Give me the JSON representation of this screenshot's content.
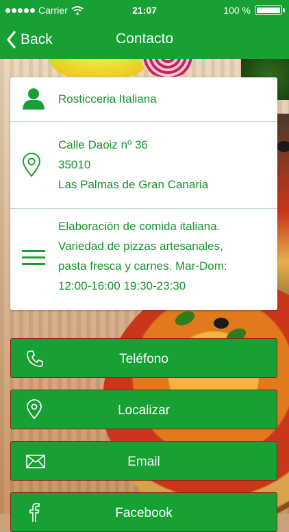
{
  "status_bar": {
    "carrier": "Carrier",
    "time": "21:07",
    "battery": "100 %"
  },
  "nav": {
    "back_label": "Back",
    "title": "Contacto"
  },
  "info": {
    "name": "Rosticceria Italiana",
    "address_lines": [
      "Calle Daoiz nº 36",
      "35010",
      "Las Palmas de Gran Canaria"
    ],
    "description_lines": [
      "Elaboración de comida italiana.",
      "Variedad de pizzas artesanales,",
      "pasta fresca y carnes. Mar-Dom:",
      "12:00-16:00 19:30-23:30"
    ]
  },
  "buttons": [
    {
      "label": "Teléfono",
      "icon": "phone-icon"
    },
    {
      "label": "Localizar",
      "icon": "location-pin-icon"
    },
    {
      "label": "Email",
      "icon": "envelope-icon"
    },
    {
      "label": "Facebook",
      "icon": "facebook-icon"
    }
  ],
  "colors": {
    "primary": "#17a033",
    "text": "#15952d",
    "divider": "#bfe0c4"
  }
}
